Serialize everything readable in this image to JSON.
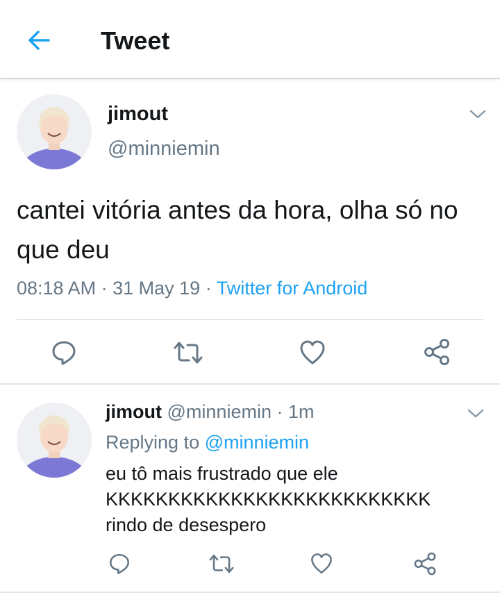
{
  "header": {
    "title": "Tweet",
    "back_icon": "arrow-left-icon",
    "accent": "#1da1f2"
  },
  "tweet": {
    "author_name": "jimout",
    "author_handle": "@minniemin",
    "text": "cantei vitória antes da hora, olha só no que deu",
    "time": "08:18 AM",
    "date": "31 May 19",
    "source": "Twitter for Android",
    "actions": [
      "reply-icon",
      "retweet-icon",
      "like-icon",
      "share-icon"
    ]
  },
  "reply": {
    "author_name": "jimout",
    "author_handle": "@minniemin",
    "age": "1m",
    "replying_label": "Replying to",
    "replying_to": "@minniemin",
    "lines": [
      "eu tô mais frustrado que ele",
      "KKKKKKKKKKKKKKKKKKKKKKKKKK",
      "rindo de desespero"
    ],
    "actions": [
      "reply-icon",
      "retweet-icon",
      "like-icon",
      "share-icon"
    ]
  },
  "colors": {
    "primary_text": "#14171a",
    "secondary_text": "#657786",
    "link": "#1da1f2",
    "divider": "#d6d9dc"
  }
}
